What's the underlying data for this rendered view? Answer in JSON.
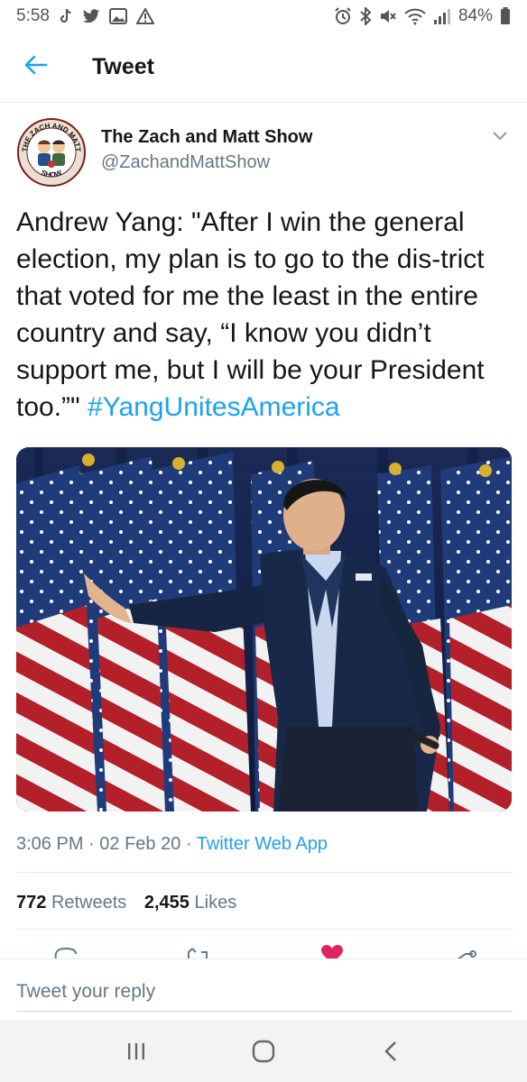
{
  "status_bar": {
    "time": "5:58",
    "battery": "84%",
    "left_icons": [
      "tiktok-icon",
      "twitter-icon",
      "gallery-icon",
      "warning-icon"
    ],
    "right_icons": [
      "alarm-icon",
      "bluetooth-icon",
      "mute-icon",
      "wifi-icon",
      "signal-icon",
      "battery-icon"
    ]
  },
  "header": {
    "title": "Tweet"
  },
  "tweet": {
    "author": {
      "display_name": "The Zach and Matt Show",
      "handle": "@ZachandMattShow",
      "avatar_text_top": "THE ZACH AND MATT",
      "avatar_text_bottom": "SHOW"
    },
    "text": "Andrew Yang: \"After I win the general election, my plan is to go to the dis-trict that voted for me the least in the entire country and say, “I know you didn’t support me, but I will be your President too.”\"",
    "hashtag": "#YangUnitesAmerica",
    "time": "3:06 PM",
    "date": "02 Feb 20",
    "source": "Twitter Web App",
    "retweets_count": "772",
    "retweets_label": "Retweets",
    "likes_count": "2,455",
    "likes_label": "Likes"
  },
  "reply": {
    "placeholder": "Tweet your reply"
  },
  "colors": {
    "accent": "#1da1f2",
    "text": "#14171a",
    "secondary": "#657786",
    "like": "#e0245e"
  }
}
